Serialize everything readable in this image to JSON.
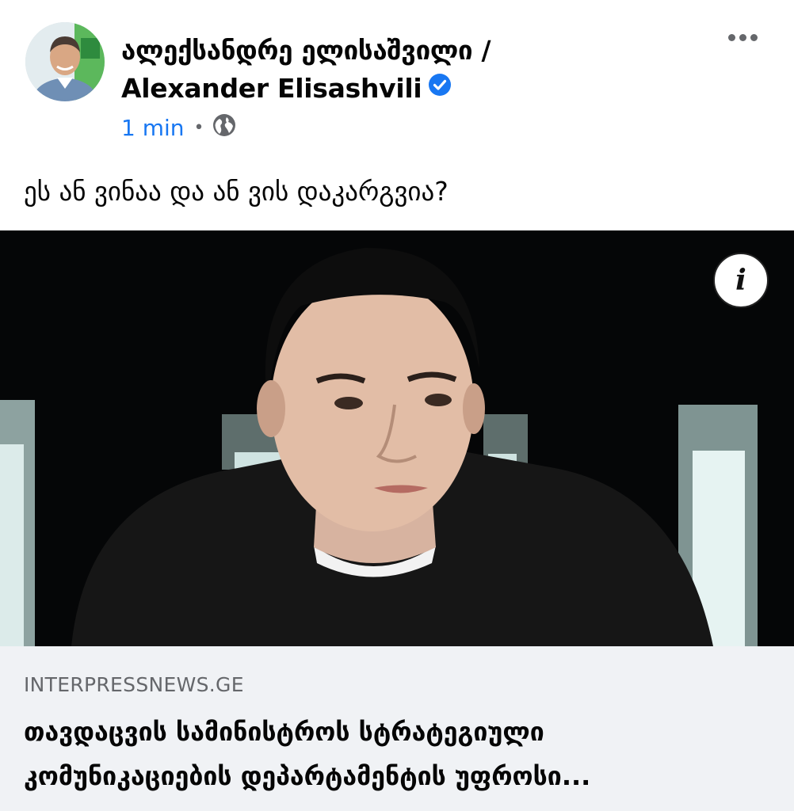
{
  "post": {
    "author": {
      "name_line1": "ალექსანდრე ელისაშვილი /",
      "name_line2": "Alexander Elisashvili",
      "avatar_icon": "profile-photo",
      "verified_icon": "verified-badge-icon"
    },
    "timestamp": "1 min",
    "separator": "•",
    "audience_icon": "globe-icon",
    "more_icon": "more-options-icon",
    "caption": "ეს ან ვინაა და ან ვის დაკარგვია?"
  },
  "media": {
    "info_label": "i",
    "info_icon": "info-icon"
  },
  "link_preview": {
    "domain": "INTERPRESSNEWS.GE",
    "title_line1": "თავდაცვის სამინისტროს სტრატეგიული",
    "title_line2": "კომუნიკაციების დეპარტამენტის უფროსი..."
  },
  "colors": {
    "accent": "#1877f2",
    "secondary_text": "#65676b",
    "card_background": "#f0f2f5"
  }
}
